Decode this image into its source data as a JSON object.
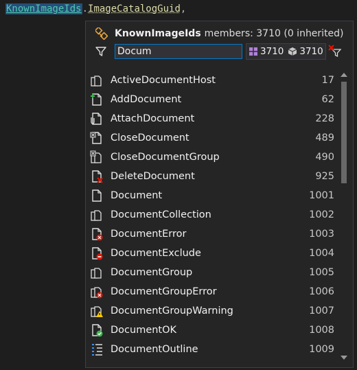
{
  "code": {
    "type_name": "KnownImageIds",
    "dot": ".",
    "member_name": "ImageCatalogGuid",
    "comma": ","
  },
  "popup": {
    "class_name": "KnownImageIds",
    "members_text": "members: 3710 (0 inherited)",
    "search_value": "Docum",
    "field_count": "3710",
    "property_count": "3710"
  },
  "items": [
    {
      "name": "ActiveDocumentHost",
      "value": "17",
      "icon": "active-document-host-icon"
    },
    {
      "name": "AddDocument",
      "value": "62",
      "icon": "add-document-icon"
    },
    {
      "name": "AttachDocument",
      "value": "228",
      "icon": "attach-document-icon"
    },
    {
      "name": "CloseDocument",
      "value": "489",
      "icon": "close-document-icon"
    },
    {
      "name": "CloseDocumentGroup",
      "value": "490",
      "icon": "close-document-group-icon"
    },
    {
      "name": "DeleteDocument",
      "value": "925",
      "icon": "delete-document-icon"
    },
    {
      "name": "Document",
      "value": "1001",
      "icon": "document-icon"
    },
    {
      "name": "DocumentCollection",
      "value": "1002",
      "icon": "document-collection-icon"
    },
    {
      "name": "DocumentError",
      "value": "1003",
      "icon": "document-error-icon"
    },
    {
      "name": "DocumentExclude",
      "value": "1004",
      "icon": "document-exclude-icon"
    },
    {
      "name": "DocumentGroup",
      "value": "1005",
      "icon": "document-group-icon"
    },
    {
      "name": "DocumentGroupError",
      "value": "1006",
      "icon": "document-group-error-icon"
    },
    {
      "name": "DocumentGroupWarning",
      "value": "1007",
      "icon": "document-group-warning-icon"
    },
    {
      "name": "DocumentOK",
      "value": "1008",
      "icon": "document-ok-icon"
    },
    {
      "name": "DocumentOutline",
      "value": "1009",
      "icon": "document-outline-icon"
    }
  ],
  "colors": {
    "type": "#4ec9b0",
    "member": "#dcdcaa",
    "accent": "#007acc",
    "background": "#1e1e1e",
    "popup": "#252526"
  }
}
